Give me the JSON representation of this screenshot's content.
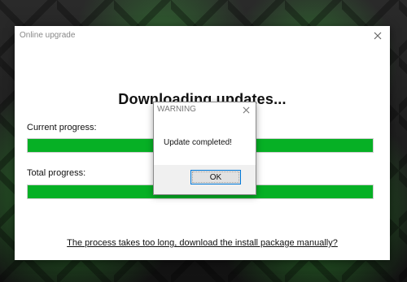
{
  "window": {
    "title": "Online upgrade",
    "heading": "Downloading updates...",
    "close_icon": "close-icon"
  },
  "progress": {
    "current_label": "Current progress:",
    "current_value_percent": 100,
    "total_label": "Total progress:",
    "total_value_percent": 100,
    "bar_color": "#06B025"
  },
  "footer": {
    "link_text": "The process takes too long, download the install package manually?"
  },
  "dialog": {
    "title": "WARNING",
    "message": "Update completed!",
    "ok_label": "OK",
    "close_icon": "close-icon"
  }
}
